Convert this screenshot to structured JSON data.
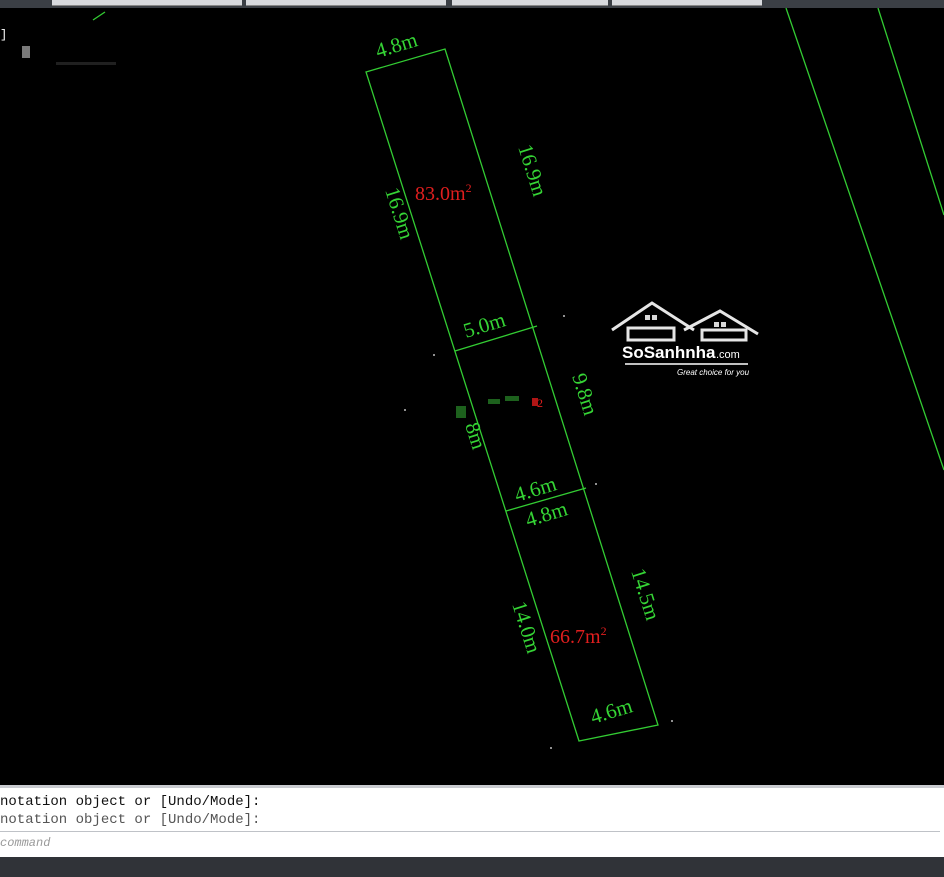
{
  "viewport": {
    "label": "]"
  },
  "drawing": {
    "dimensions": {
      "top_width": "4.8m",
      "left_upper": "16.9m",
      "right_upper": "16.9m",
      "mid_width": "5.0m",
      "right_middle": "9.8m",
      "left_middle": "8m",
      "lower_mid_width_a": "4.6m",
      "lower_mid_width_b": "4.8m",
      "right_lower": "14.5m",
      "left_lower": "14.0m",
      "bottom_width": "4.6m"
    },
    "areas": {
      "upper": "83.0m",
      "middle": "2",
      "lower": "66.7m"
    },
    "colors": {
      "lines": "#33cc33",
      "dims": "#35d435",
      "area": "#e01e1e"
    }
  },
  "watermark": {
    "brand": "SoSanhnha",
    "domain": ".com",
    "tagline": "Great choice for you"
  },
  "command": {
    "history_line_1": "notation object or [Undo/Mode]:",
    "history_line_2": "notation object or [Undo/Mode]:",
    "input_placeholder": "command"
  }
}
